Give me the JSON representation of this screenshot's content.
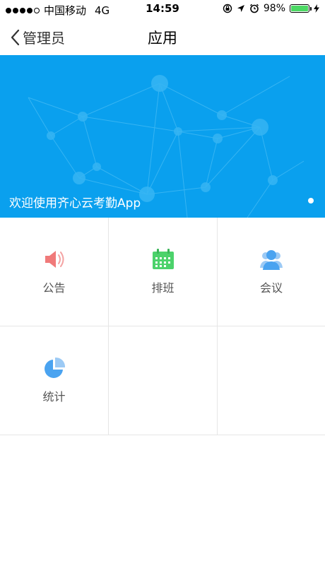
{
  "status_bar": {
    "carrier": "中国移动",
    "network": "4G",
    "time": "14:59",
    "battery_percent": "98%",
    "battery_level": 0.98,
    "signal_bars_filled": 4,
    "signal_bars_total": 5
  },
  "nav": {
    "back_label": "管理员",
    "title": "应用"
  },
  "banner": {
    "caption": "欢迎使用齐心云考勤App",
    "background_color": "#0aa0ee",
    "page_count": 1,
    "active_page": 1
  },
  "apps": [
    {
      "label": "公告",
      "icon": "speaker-icon",
      "color": "#f07a7a"
    },
    {
      "label": "排班",
      "icon": "calendar-icon",
      "color": "#4cd26b"
    },
    {
      "label": "会议",
      "icon": "people-icon",
      "color": "#4aa3f0"
    },
    {
      "label": "统计",
      "icon": "pie-chart-icon",
      "color": "#4aa3f0"
    }
  ]
}
